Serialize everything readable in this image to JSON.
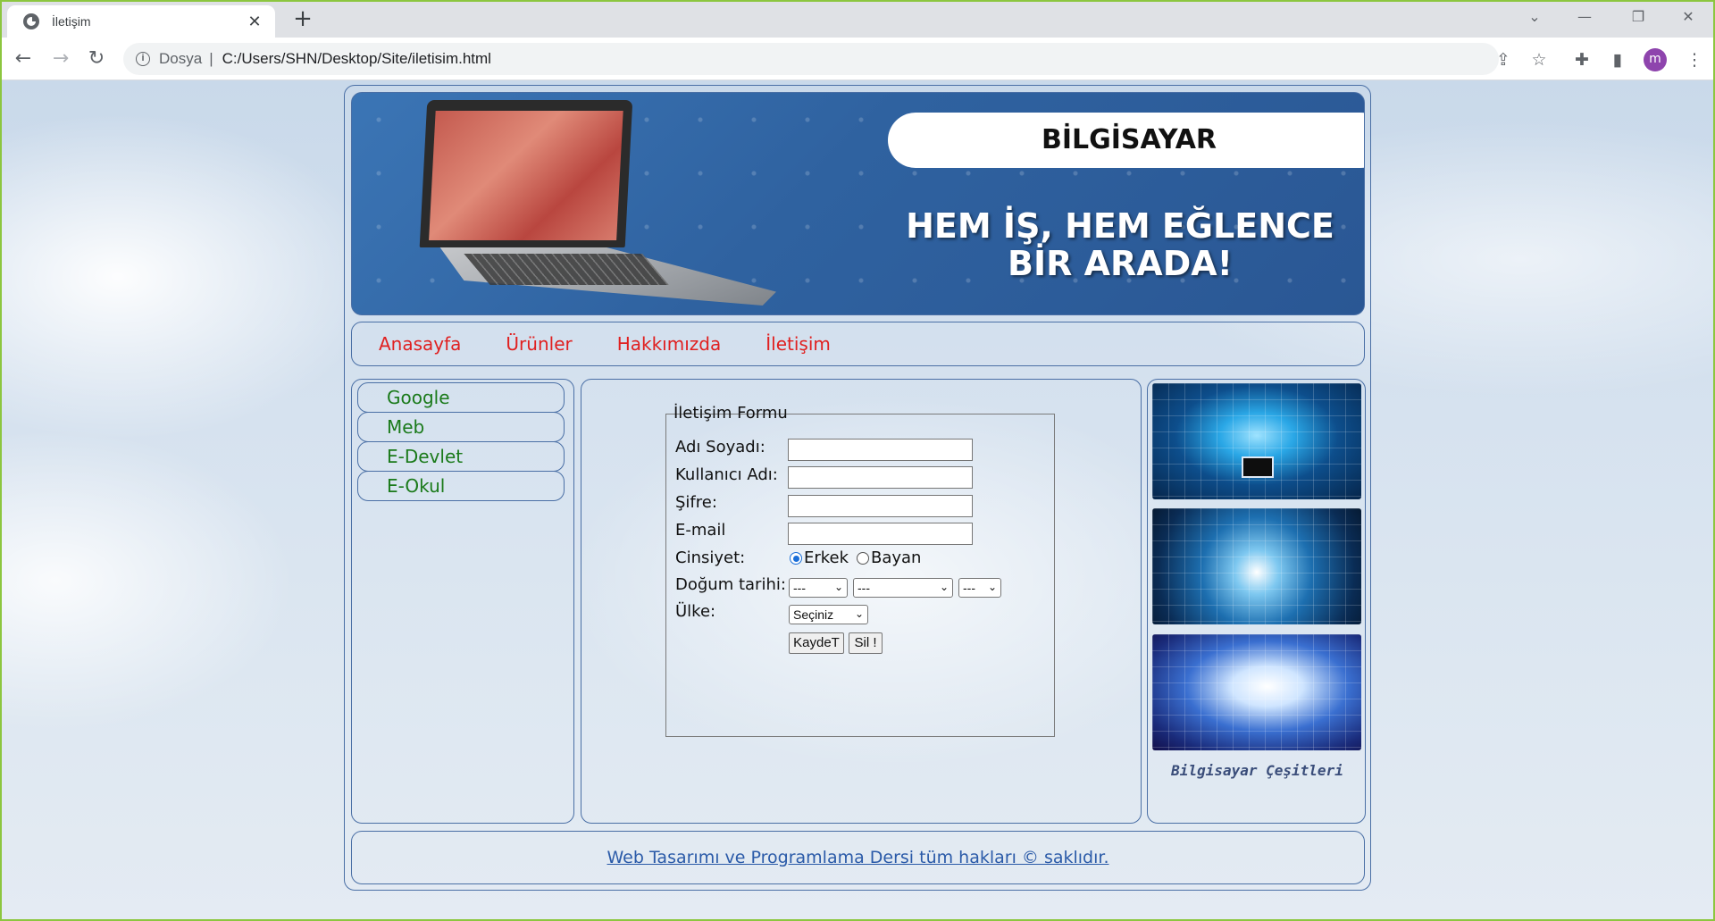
{
  "browser": {
    "tab_title": "İletişim",
    "tab_close": "✕",
    "new_tab": "+",
    "address_scheme": "Dosya",
    "address_separator": "|",
    "address_url": "C:/Users/SHN/Desktop/Site/iletisim.html",
    "profile_initial": "m"
  },
  "banner": {
    "brand": "BİLGİSAYAR",
    "slogan_line1": "HEM İŞ, HEM EĞLENCE",
    "slogan_line2": "BİR ARADA!"
  },
  "nav": {
    "items": [
      "Anasayfa",
      "Ürünler",
      "Hakkımızda",
      "İletişim"
    ]
  },
  "sidebar": {
    "links": [
      "Google",
      "Meb",
      "E-Devlet",
      "E-Okul"
    ]
  },
  "form": {
    "legend": "İletişim Formu",
    "labels": {
      "name": "Adı Soyadı:",
      "username": "Kullanıcı Adı:",
      "password": "Şifre:",
      "email": "E-mail",
      "gender": "Cinsiyet:",
      "birthdate": "Doğum tarihi:",
      "country": "Ülke:"
    },
    "gender_options": [
      "Erkek",
      "Bayan"
    ],
    "gender_selected": "Erkek",
    "birth_day": "---",
    "birth_month": "---",
    "birth_year": "---",
    "country_selected": "Seçiniz",
    "save_label": "KaydeT",
    "clear_label": "Sil !"
  },
  "right": {
    "caption": "Bilgisayar Çeşitleri"
  },
  "footer": {
    "text": "Web Tasarımı ve Programlama Dersi tüm hakları © saklıdır."
  },
  "colors": {
    "nav_link": "#e02020",
    "sidebar_link": "#1a7a1a",
    "border": "#4a6fa5",
    "footer_link": "#2a5aa8"
  }
}
